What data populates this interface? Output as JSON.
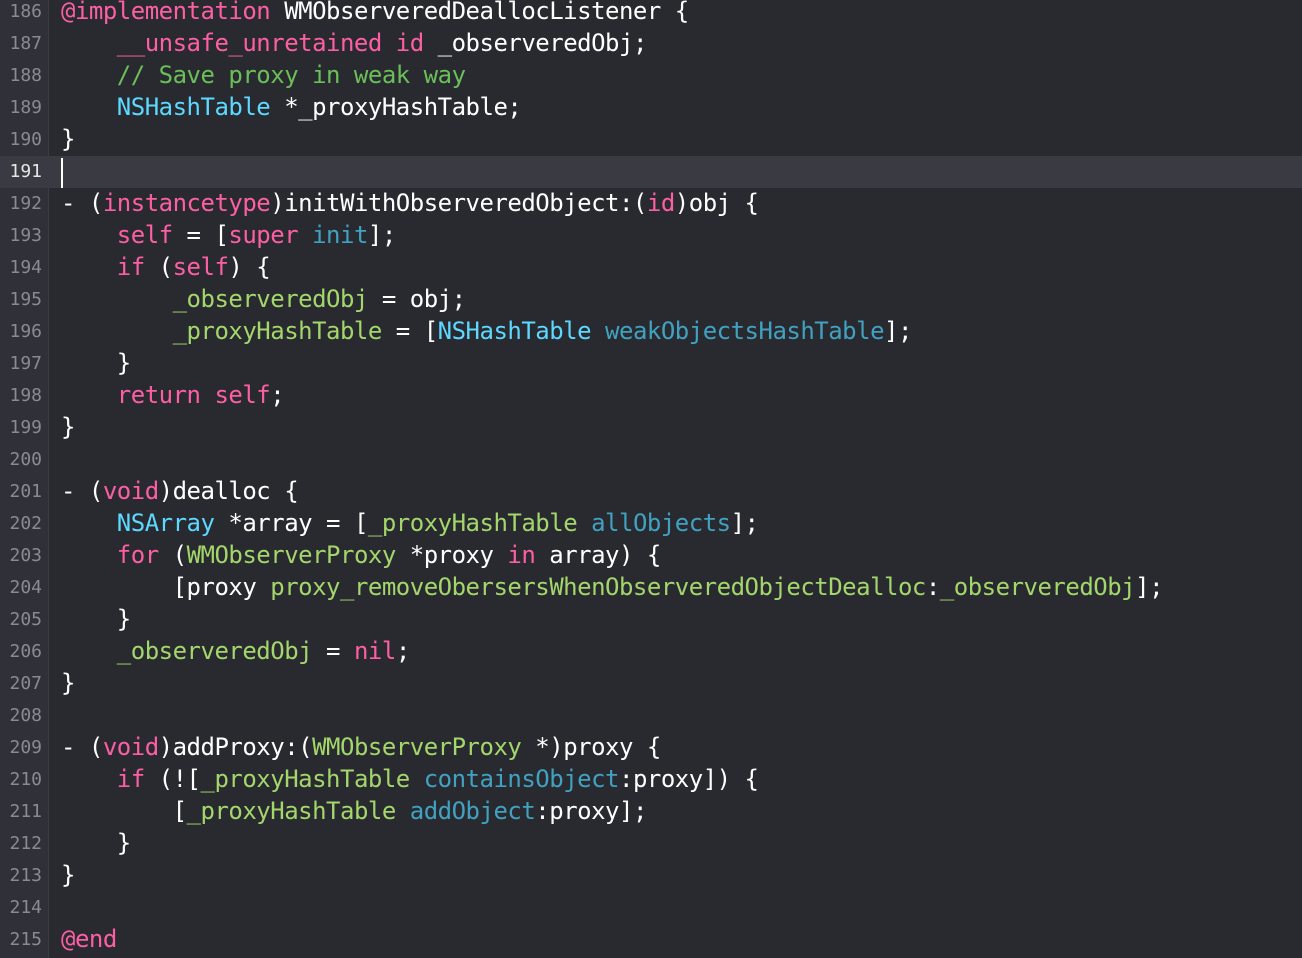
{
  "editor": {
    "current_line": "191",
    "lines": [
      {
        "num": "186",
        "tokens": [
          [
            "@implementation",
            "kw"
          ],
          [
            " WMObserveredDeallocListener {",
            "plain"
          ]
        ]
      },
      {
        "num": "187",
        "tokens": [
          [
            "    ",
            "plain"
          ],
          [
            "__unsafe_unretained",
            "kw"
          ],
          [
            " ",
            "plain"
          ],
          [
            "id",
            "kw"
          ],
          [
            " _observeredObj;",
            "plain"
          ]
        ]
      },
      {
        "num": "188",
        "tokens": [
          [
            "    ",
            "plain"
          ],
          [
            "// Save proxy in weak way",
            "comment"
          ]
        ]
      },
      {
        "num": "189",
        "tokens": [
          [
            "    ",
            "plain"
          ],
          [
            "NSHashTable",
            "type"
          ],
          [
            " *_proxyHashTable;",
            "plain"
          ]
        ]
      },
      {
        "num": "190",
        "tokens": [
          [
            "}",
            "plain"
          ]
        ]
      },
      {
        "num": "191",
        "tokens": []
      },
      {
        "num": "192",
        "tokens": [
          [
            "- (",
            "plain"
          ],
          [
            "instancetype",
            "kw"
          ],
          [
            ")initWithObserveredObject:(",
            "plain"
          ],
          [
            "id",
            "kw"
          ],
          [
            ")obj {",
            "plain"
          ]
        ]
      },
      {
        "num": "193",
        "tokens": [
          [
            "    ",
            "plain"
          ],
          [
            "self",
            "kw"
          ],
          [
            " = [",
            "plain"
          ],
          [
            "super",
            "kw"
          ],
          [
            " ",
            "plain"
          ],
          [
            "init",
            "method"
          ],
          [
            "];",
            "plain"
          ]
        ]
      },
      {
        "num": "194",
        "tokens": [
          [
            "    ",
            "plain"
          ],
          [
            "if",
            "kw"
          ],
          [
            " (",
            "plain"
          ],
          [
            "self",
            "kw"
          ],
          [
            ") {",
            "plain"
          ]
        ]
      },
      {
        "num": "195",
        "tokens": [
          [
            "        ",
            "plain"
          ],
          [
            "_observeredObj",
            "ivar"
          ],
          [
            " = obj;",
            "plain"
          ]
        ]
      },
      {
        "num": "196",
        "tokens": [
          [
            "        ",
            "plain"
          ],
          [
            "_proxyHashTable",
            "ivar"
          ],
          [
            " = [",
            "plain"
          ],
          [
            "NSHashTable",
            "type"
          ],
          [
            " ",
            "plain"
          ],
          [
            "weakObjectsHashTable",
            "method"
          ],
          [
            "];",
            "plain"
          ]
        ]
      },
      {
        "num": "197",
        "tokens": [
          [
            "    }",
            "plain"
          ]
        ]
      },
      {
        "num": "198",
        "tokens": [
          [
            "    ",
            "plain"
          ],
          [
            "return",
            "kw"
          ],
          [
            " ",
            "plain"
          ],
          [
            "self",
            "kw"
          ],
          [
            ";",
            "plain"
          ]
        ]
      },
      {
        "num": "199",
        "tokens": [
          [
            "}",
            "plain"
          ]
        ]
      },
      {
        "num": "200",
        "tokens": []
      },
      {
        "num": "201",
        "tokens": [
          [
            "- (",
            "plain"
          ],
          [
            "void",
            "kw"
          ],
          [
            ")dealloc {",
            "plain"
          ]
        ]
      },
      {
        "num": "202",
        "tokens": [
          [
            "    ",
            "plain"
          ],
          [
            "NSArray",
            "type"
          ],
          [
            " *array = [",
            "plain"
          ],
          [
            "_proxyHashTable",
            "ivar"
          ],
          [
            " ",
            "plain"
          ],
          [
            "allObjects",
            "method"
          ],
          [
            "];",
            "plain"
          ]
        ]
      },
      {
        "num": "203",
        "tokens": [
          [
            "    ",
            "plain"
          ],
          [
            "for",
            "kw"
          ],
          [
            " (",
            "plain"
          ],
          [
            "WMObserverProxy",
            "ivar"
          ],
          [
            " *proxy ",
            "plain"
          ],
          [
            "in",
            "kw"
          ],
          [
            " array) {",
            "plain"
          ]
        ]
      },
      {
        "num": "204",
        "tokens": [
          [
            "        [proxy ",
            "plain"
          ],
          [
            "proxy_removeObersersWhenObserveredObjectDealloc",
            "ivar"
          ],
          [
            ":",
            "plain"
          ],
          [
            "_observeredObj",
            "ivar"
          ],
          [
            "];",
            "plain"
          ]
        ]
      },
      {
        "num": "205",
        "tokens": [
          [
            "    }",
            "plain"
          ]
        ]
      },
      {
        "num": "206",
        "tokens": [
          [
            "    ",
            "plain"
          ],
          [
            "_observeredObj",
            "ivar"
          ],
          [
            " = ",
            "plain"
          ],
          [
            "nil",
            "kw"
          ],
          [
            ";",
            "plain"
          ]
        ]
      },
      {
        "num": "207",
        "tokens": [
          [
            "}",
            "plain"
          ]
        ]
      },
      {
        "num": "208",
        "tokens": []
      },
      {
        "num": "209",
        "tokens": [
          [
            "- (",
            "plain"
          ],
          [
            "void",
            "kw"
          ],
          [
            ")addProxy:(",
            "plain"
          ],
          [
            "WMObserverProxy",
            "ivar"
          ],
          [
            " *)proxy {",
            "plain"
          ]
        ]
      },
      {
        "num": "210",
        "tokens": [
          [
            "    ",
            "plain"
          ],
          [
            "if",
            "kw"
          ],
          [
            " (![",
            "plain"
          ],
          [
            "_proxyHashTable",
            "ivar"
          ],
          [
            " ",
            "plain"
          ],
          [
            "containsObject",
            "method"
          ],
          [
            ":proxy]) {",
            "plain"
          ]
        ]
      },
      {
        "num": "211",
        "tokens": [
          [
            "        [",
            "plain"
          ],
          [
            "_proxyHashTable",
            "ivar"
          ],
          [
            " ",
            "plain"
          ],
          [
            "addObject",
            "method"
          ],
          [
            ":proxy];",
            "plain"
          ]
        ]
      },
      {
        "num": "212",
        "tokens": [
          [
            "    }",
            "plain"
          ]
        ]
      },
      {
        "num": "213",
        "tokens": [
          [
            "}",
            "plain"
          ]
        ]
      },
      {
        "num": "214",
        "tokens": []
      },
      {
        "num": "215",
        "tokens": [
          [
            "@end",
            "kw"
          ]
        ]
      }
    ]
  },
  "colors": {
    "background": "#292a30",
    "gutter": "#2f3038",
    "current_line": "#3a3b42",
    "keyword": "#fc5fa3",
    "type": "#5dd8ff",
    "method": "#41a1c0",
    "comment": "#6bbf59",
    "ivar": "#a3d66b",
    "plain": "#ffffff",
    "line_number": "#8a8b92"
  }
}
